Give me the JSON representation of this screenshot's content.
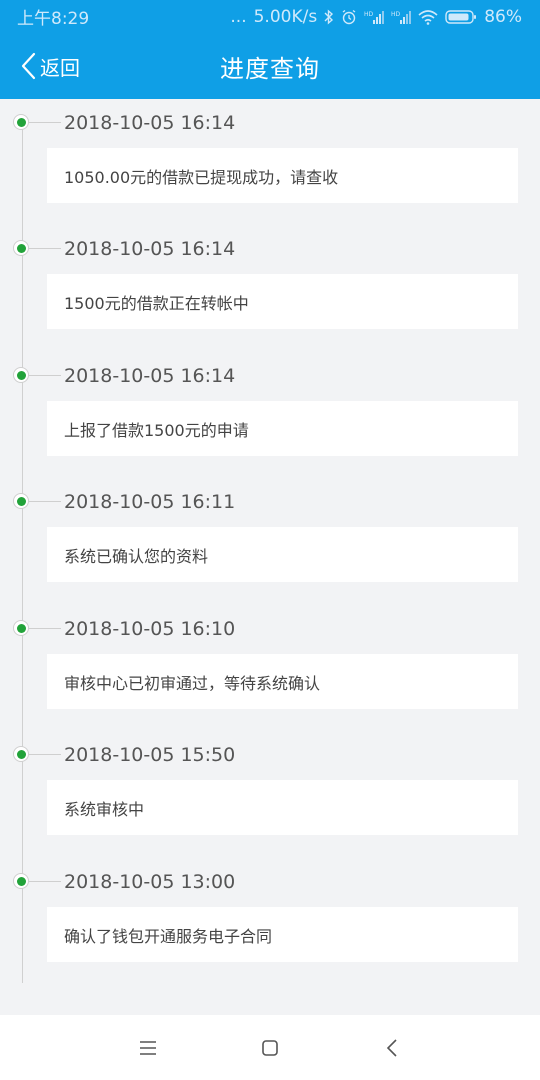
{
  "status_bar": {
    "time": "上午8:29",
    "dots": "...",
    "net_speed": "5.00K/s",
    "battery": "86%",
    "icons": [
      "bluetooth-icon",
      "alarm-icon",
      "signal-hd-icon",
      "signal-hd-icon",
      "wifi-icon",
      "battery-icon"
    ]
  },
  "header": {
    "back_label": "返回",
    "title": "进度查询",
    "color": "#0f9fe6"
  },
  "timeline": {
    "items": [
      {
        "time": "2018-10-05 16:14",
        "message": "1050.00元的借款已提现成功，请查收"
      },
      {
        "time": "2018-10-05 16:14",
        "message": "1500元的借款正在转帐中"
      },
      {
        "time": "2018-10-05 16:14",
        "message": "上报了借款1500元的申请"
      },
      {
        "time": "2018-10-05 16:11",
        "message": "系统已确认您的资料"
      },
      {
        "time": "2018-10-05 16:10",
        "message": "审核中心已初审通过，等待系统确认"
      },
      {
        "time": "2018-10-05 15:50",
        "message": "系统审核中"
      },
      {
        "time": "2018-10-05 13:00",
        "message": "确认了钱包开通服务电子合同"
      }
    ],
    "dot_color": "#22a33a"
  },
  "nav_bar": {
    "icons": [
      "menu-icon",
      "home-icon",
      "back-icon"
    ]
  }
}
